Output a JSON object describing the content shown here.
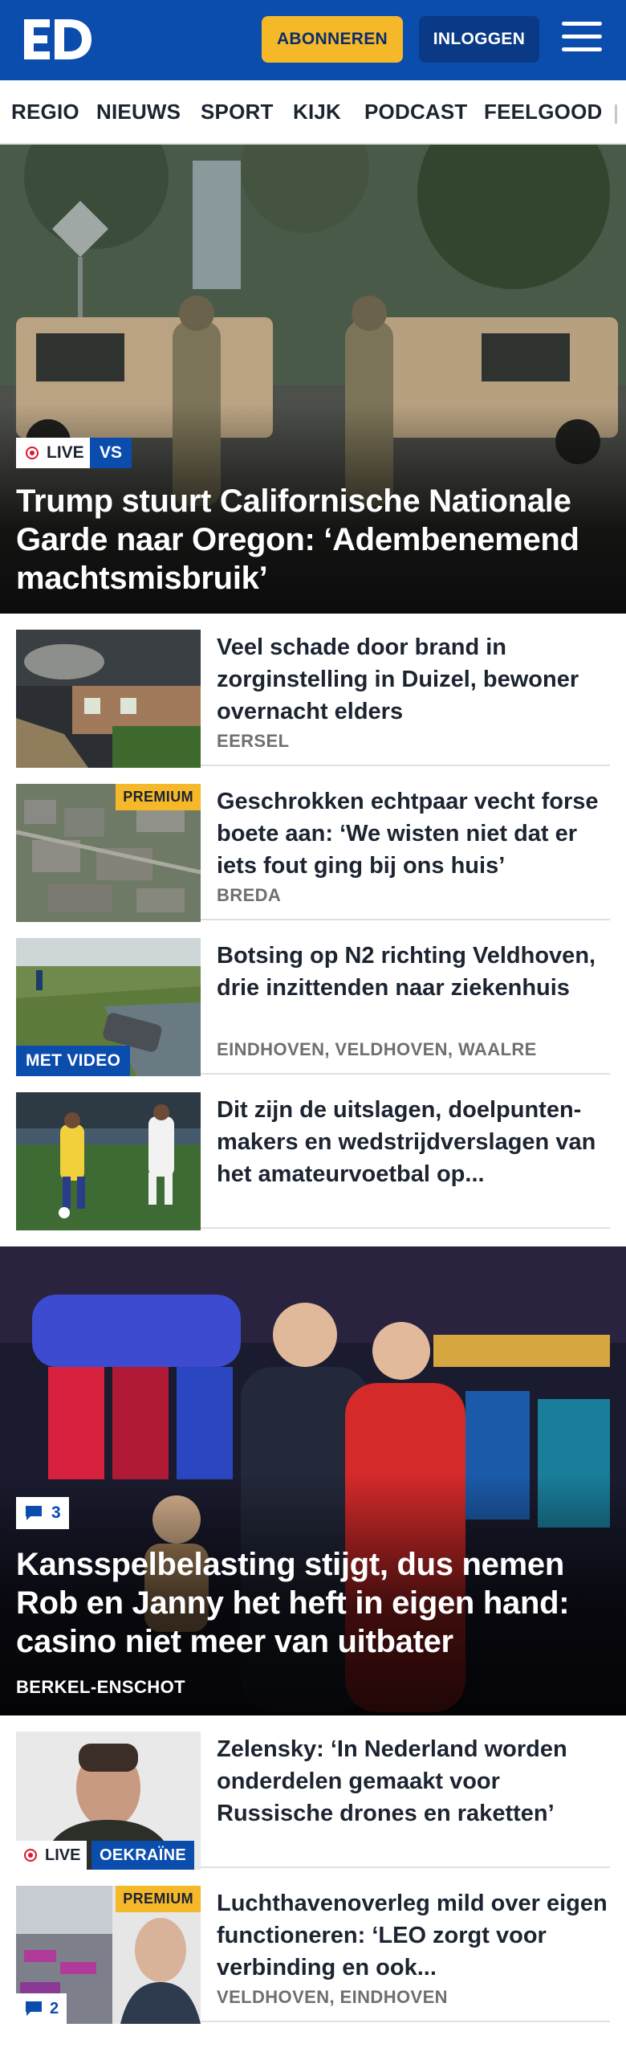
{
  "header": {
    "logo_text": "ED",
    "subscribe_label": "ABONNEREN",
    "login_label": "INLOGGEN",
    "menu_icon": "hamburger-menu-icon",
    "brand_color": "#0a4dad",
    "accent_color": "#f5b829"
  },
  "nav": {
    "items": [
      "REGIO",
      "NIEUWS",
      "SPORT",
      "KIJK",
      "PODCAST",
      "FEELGOOD"
    ]
  },
  "hero": {
    "live_label": "LIVE",
    "tag": "VS",
    "title": "Trump stuurt Californische Nationale Garde naar Oregon: ‘Adembenemend machtsmisbruik’"
  },
  "articles": [
    {
      "title": "Veel schade door brand in zorginstelling in Duizel, bewoner overnacht elders",
      "place": "EERSEL"
    },
    {
      "premium": "PREMIUM",
      "title": "Geschrokken echtpaar vecht forse boete aan: ‘We wisten niet dat er iets fout ging bij ons huis’",
      "place": "BREDA"
    },
    {
      "video": "MET VIDEO",
      "title": "Botsing op N2 richting Veldhoven, drie inzittenden naar ziekenhuis",
      "place": "EINDHOVEN, VELDHOVEN, WAALRE"
    },
    {
      "title": "Dit zijn de uitslagen, doelpunten­makers en wedstrijdverslagen van het amateurvoetbal op..."
    }
  ],
  "feature": {
    "comments": "3",
    "title": "Kansspelbelasting stijgt, dus nemen Rob en Janny het heft in eigen hand: casino niet meer van uitbater",
    "place": "BERKEL-ENSCHOT"
  },
  "articles2": [
    {
      "live_label": "LIVE",
      "tag": "OEKRAÏNE",
      "title": "Zelensky: ‘In Nederland worden onderdelen gemaakt voor Russische drones en raketten’"
    },
    {
      "premium": "PREMIUM",
      "comments": "2",
      "title": "Luchthavenoverleg mild over eigen functioneren: ‘LEO zorgt voor verbinding en ook...",
      "place": "VELDHOVEN, EINDHOVEN"
    }
  ]
}
